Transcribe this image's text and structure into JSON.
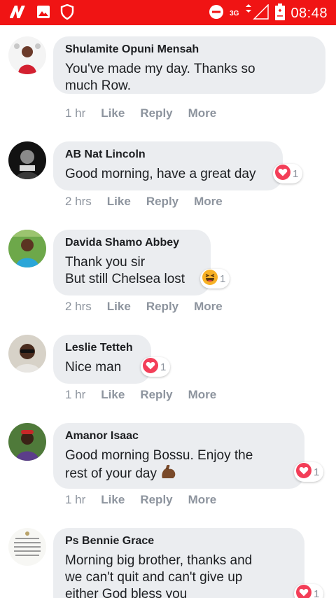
{
  "status_bar": {
    "time": "08:48",
    "network": "3G",
    "left_icons": [
      "app-n-icon",
      "gallery-icon",
      "shield-icon"
    ],
    "right_icons": [
      "do-not-disturb-icon",
      "signal-icon",
      "battery-icon"
    ],
    "color": "#f01414"
  },
  "actions": {
    "like": "Like",
    "reply": "Reply",
    "more": "More"
  },
  "comments": [
    {
      "author": "Shulamite Opuni Mensah",
      "text": "You've made my day. Thanks so\nmuch Row.",
      "time": "1 hr"
    },
    {
      "author": "AB Nat Lincoln",
      "text": "Good morning, have a great day",
      "time": "2 hrs",
      "reaction": {
        "icon": "love-icon",
        "count": "1"
      }
    },
    {
      "author": "Davida Shamo Abbey",
      "text": "Thank you sir\nBut still Chelsea lost",
      "time": "2 hrs",
      "reaction": {
        "icon": "haha-icon",
        "count": "1"
      }
    },
    {
      "author": "Leslie Tetteh",
      "text": "Nice man",
      "time": "1 hr",
      "reaction": {
        "icon": "love-icon",
        "count": "1"
      }
    },
    {
      "author": "Amanor Isaac",
      "text": "Good morning Bossu. Enjoy the\nrest of your day",
      "emoji": "flexed-biceps-icon",
      "time": "1 hr",
      "reaction": {
        "icon": "love-icon",
        "count": "1"
      }
    },
    {
      "author": "Ps Bennie Grace",
      "text": "Morning big brother, thanks and\nwe can't quit and can't give up\neither God bless you",
      "reaction": {
        "icon": "love-icon",
        "count": "1"
      }
    }
  ],
  "colors": {
    "bubble": "#ebedf0",
    "meta": "#8d949e",
    "love": "#f33e58",
    "haha": "#f7b125"
  }
}
